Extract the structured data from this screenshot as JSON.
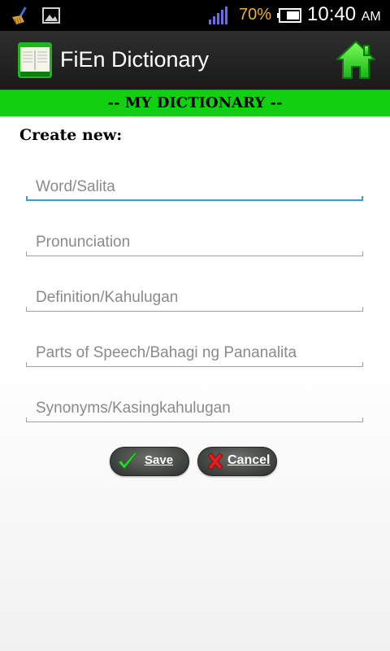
{
  "status_bar": {
    "battery_percent": "70%",
    "time": "10:40",
    "ampm": "AM",
    "icons": [
      "broom-icon",
      "gallery-icon",
      "signal-icon",
      "battery-icon"
    ]
  },
  "action_bar": {
    "title": "FiEn Dictionary",
    "logo_icon": "dictionary-book-icon",
    "home_icon": "home-icon"
  },
  "banner": {
    "text": "-- MY DICTIONARY --"
  },
  "form": {
    "heading": "Create new:",
    "fields": [
      {
        "placeholder": "Word/Salita",
        "value": "",
        "focused": true
      },
      {
        "placeholder": "Pronunciation",
        "value": ""
      },
      {
        "placeholder": "Definition/Kahulugan",
        "value": ""
      },
      {
        "placeholder": "Parts of Speech/Bahagi ng Pananalita",
        "value": ""
      },
      {
        "placeholder": "Synonyms/Kasingkahulugan",
        "value": ""
      }
    ],
    "save_label": "Save",
    "cancel_label": "Cancel"
  },
  "colors": {
    "banner_green": "#10d010",
    "focus_blue": "#3a9fc8",
    "battery_orange": "#f0b030"
  }
}
